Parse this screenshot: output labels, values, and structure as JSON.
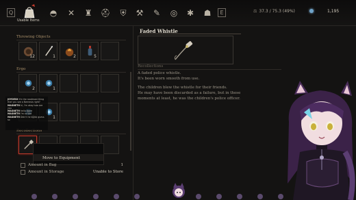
{
  "topbar": {
    "left_key": "Q",
    "right_key": "E",
    "active_tab_label": "Usable Items",
    "icons": [
      "bag-icon",
      "horn-icon",
      "swords-icon",
      "armor-icon",
      "helmet-icon",
      "shield-icon",
      "ring-icon",
      "hammer-icon",
      "bug-icon",
      "feather-icon",
      "skull-icon",
      "quiver-icon"
    ],
    "weight": "37.3 / 75.3 (49%)",
    "souls": "1,195"
  },
  "left": {
    "section_throwing": "Throwing Objects",
    "section_ergo": "Ergo",
    "section_recollections": "Recollections",
    "throwing_slots": [
      {
        "qty": "12",
        "icon": "grenade-icon"
      },
      {
        "qty": "1",
        "icon": "throwing-cell-icon"
      },
      {
        "qty": "2",
        "icon": "fire-pot-icon"
      },
      {
        "qty": "5",
        "icon": "electric-bottle-icon"
      },
      {
        "qty": "",
        "icon": ""
      }
    ],
    "ergo_slots": [
      {
        "qty": "2",
        "icon": "ergo-icon"
      },
      {
        "qty": "1",
        "icon": "ergo-icon"
      },
      {
        "qty": "",
        "icon": ""
      },
      {
        "qty": "",
        "icon": ""
      },
      {
        "qty": "",
        "icon": ""
      }
    ],
    "ergo_slots_row2": [
      {
        "qty": "2",
        "icon": "ergo-icon"
      },
      {
        "qty": "1",
        "icon": "ergo-icon"
      }
    ],
    "recollection_slots": [
      {
        "qty": "",
        "icon": "whistle-icon"
      }
    ],
    "context_menu_item": "Move to Equipment",
    "amount_in_bag_label": "Amount in Bag",
    "amount_in_bag_value": "1",
    "amount_in_storage_label": "Amount in Storage",
    "amount_in_storage_value": "Unable to Store"
  },
  "chat": [
    {
      "user": "JOYDESK",
      "text": "It's the roadmost thing that you see a Nemesis right?"
    },
    {
      "user": "MAGNETH",
      "text": "hi, I'm okay how are you"
    },
    {
      "user": "MAGNETH",
      "text": "hello there"
    },
    {
      "user": "MAGNETH",
      "text": "I'm so sad"
    },
    {
      "user": "MAGNETH",
      "text": "Didn't he kinda guess so"
    }
  ],
  "detail": {
    "title": "Faded Whistle",
    "recollections_label": "Recollections",
    "lines_1": [
      "A faded police whistle.",
      "It's been worn smooth from use."
    ],
    "lines_2": [
      "The children blew the whistle for their friends.",
      "He may have been discarded as a failure, but in those",
      "moments at least, he was the children's police officer."
    ]
  },
  "colors": {
    "accent_red": "#c13a2c",
    "gold_label": "#a88f6a",
    "soul_blue": "#6fa3c9"
  }
}
